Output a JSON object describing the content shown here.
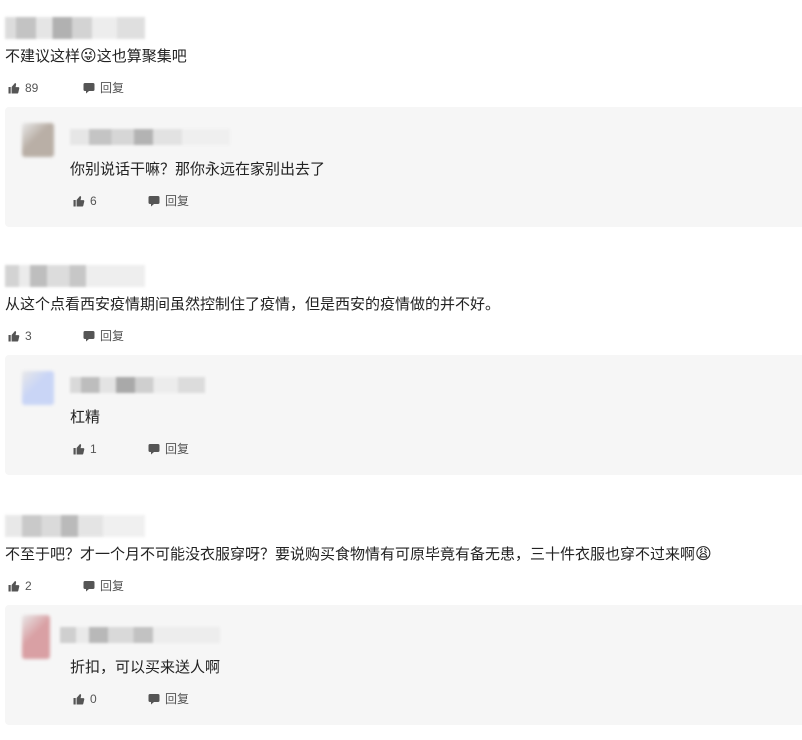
{
  "comments": [
    {
      "text": "不建议这样",
      "emoji": "😜",
      "text_after": "这也算聚集吧",
      "likes": "89",
      "reply_label": "回复",
      "reply": {
        "avatar_color": "#b9afa6",
        "text": "你别说话干嘛？那你永远在家别出去了",
        "likes": "6",
        "reply_label": "回复"
      }
    },
    {
      "text": "从这个点看西安疫情期间虽然控制住了疫情，但是西安的疫情做的并不好。",
      "likes": "3",
      "reply_label": "回复",
      "reply": {
        "avatar_color": "#c9d5f6",
        "text": "杠精",
        "likes": "1",
        "reply_label": "回复"
      }
    },
    {
      "text": "不至于吧？才一个月不可能没衣服穿呀？要说购买食物情有可原毕竟有备无患，三十件衣服也穿不过来啊",
      "emoji": "😩",
      "likes": "2",
      "reply_label": "回复",
      "reply": {
        "avatar_color": "#d9a0a4",
        "text": "折扣，可以买来送人啊",
        "likes": "0",
        "reply_label": "回复"
      }
    }
  ]
}
